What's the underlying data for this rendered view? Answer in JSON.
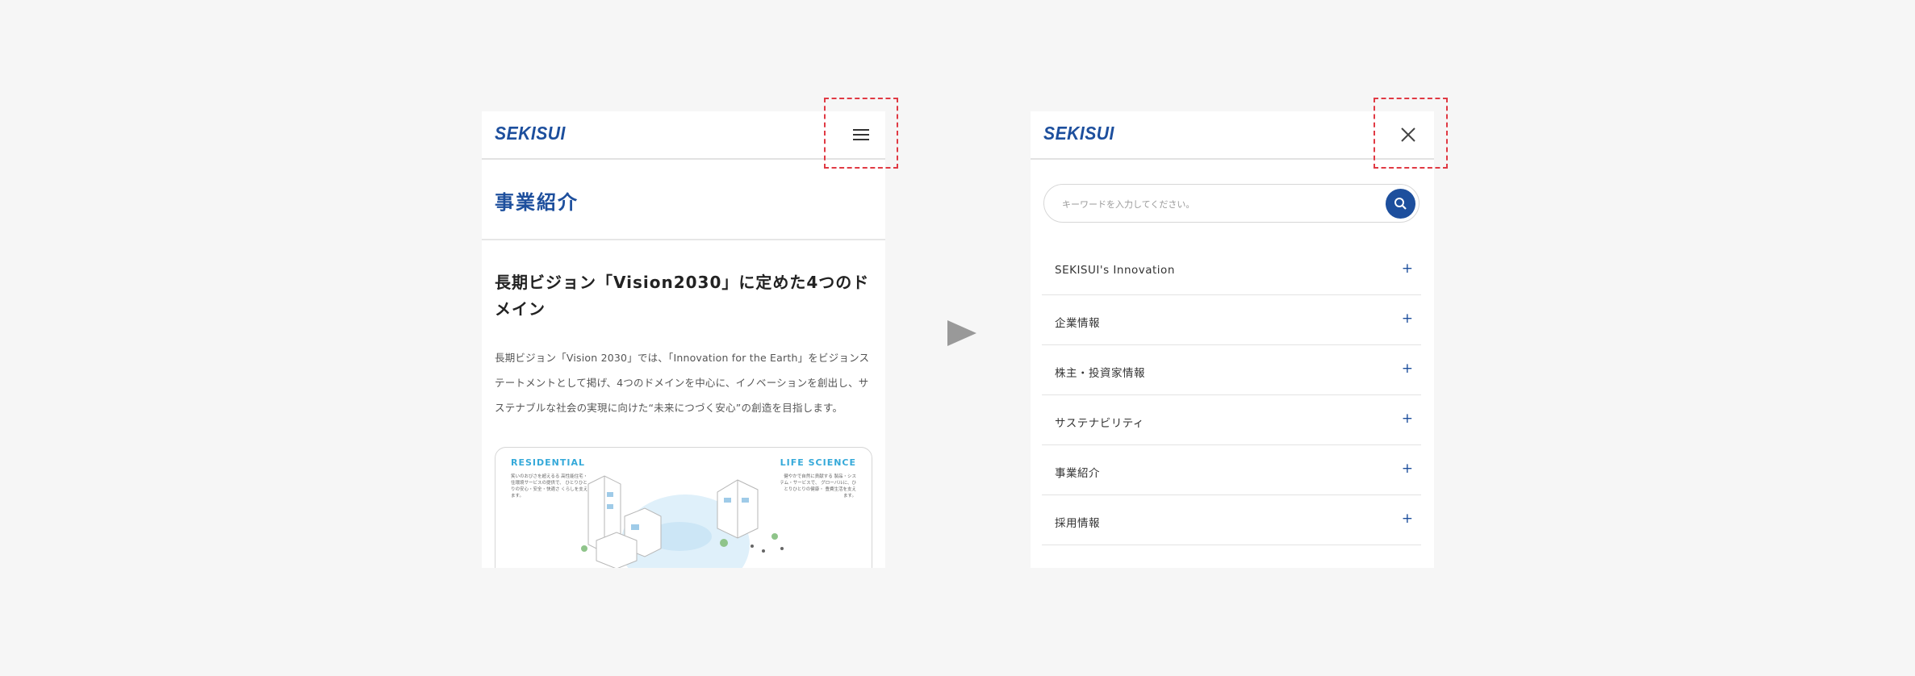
{
  "left_screen": {
    "logo": "SEKISUI",
    "menu_icon": "hamburger-icon",
    "page_title": "事業紹介",
    "heading": "長期ビジョン「Vision2030」に定めた4つのドメイン",
    "body": "長期ビジョン「Vision 2030」では、「Innovation for the Earth」をビジョンステートメントとして掲げ、4つのドメインを中心に、イノベーションを創出し、サステナブルな社会の実現に向けた“未来につづく安心”の創造を目指します。",
    "illustration": {
      "residential_label": "RESIDENTIAL",
      "life_science_label": "LIFE SCIENCE",
      "residential_text": "笑いのおびさを超えるる 高性能住宅・住環境サービスの提供で、 ひとりひとりの安心・安全・快適さ くらしを支えます。",
      "life_science_text": "健やかで自然に貢献する 製品・システム・サービスで、 グローバルに、ひとりひとりの健康・ 豊費生活を支えます。"
    }
  },
  "right_screen": {
    "logo": "SEKISUI",
    "close_icon": "close-icon",
    "search": {
      "placeholder": "キーワードを入力してください。",
      "icon": "search-icon"
    },
    "menu": [
      {
        "label": "SEKISUI's Innovation",
        "icon": "+"
      },
      {
        "label": "企業情報",
        "icon": "+"
      },
      {
        "label": "株主・投資家情報",
        "icon": "+"
      },
      {
        "label": "サステナビリティ",
        "icon": "+"
      },
      {
        "label": "事業紹介",
        "icon": "+"
      },
      {
        "label": "採用情報",
        "icon": "+"
      }
    ]
  },
  "colors": {
    "brand": "#1d4f9d",
    "highlight": "#e03a44",
    "accent": "#35a9d9",
    "background": "#f6f6f6"
  }
}
